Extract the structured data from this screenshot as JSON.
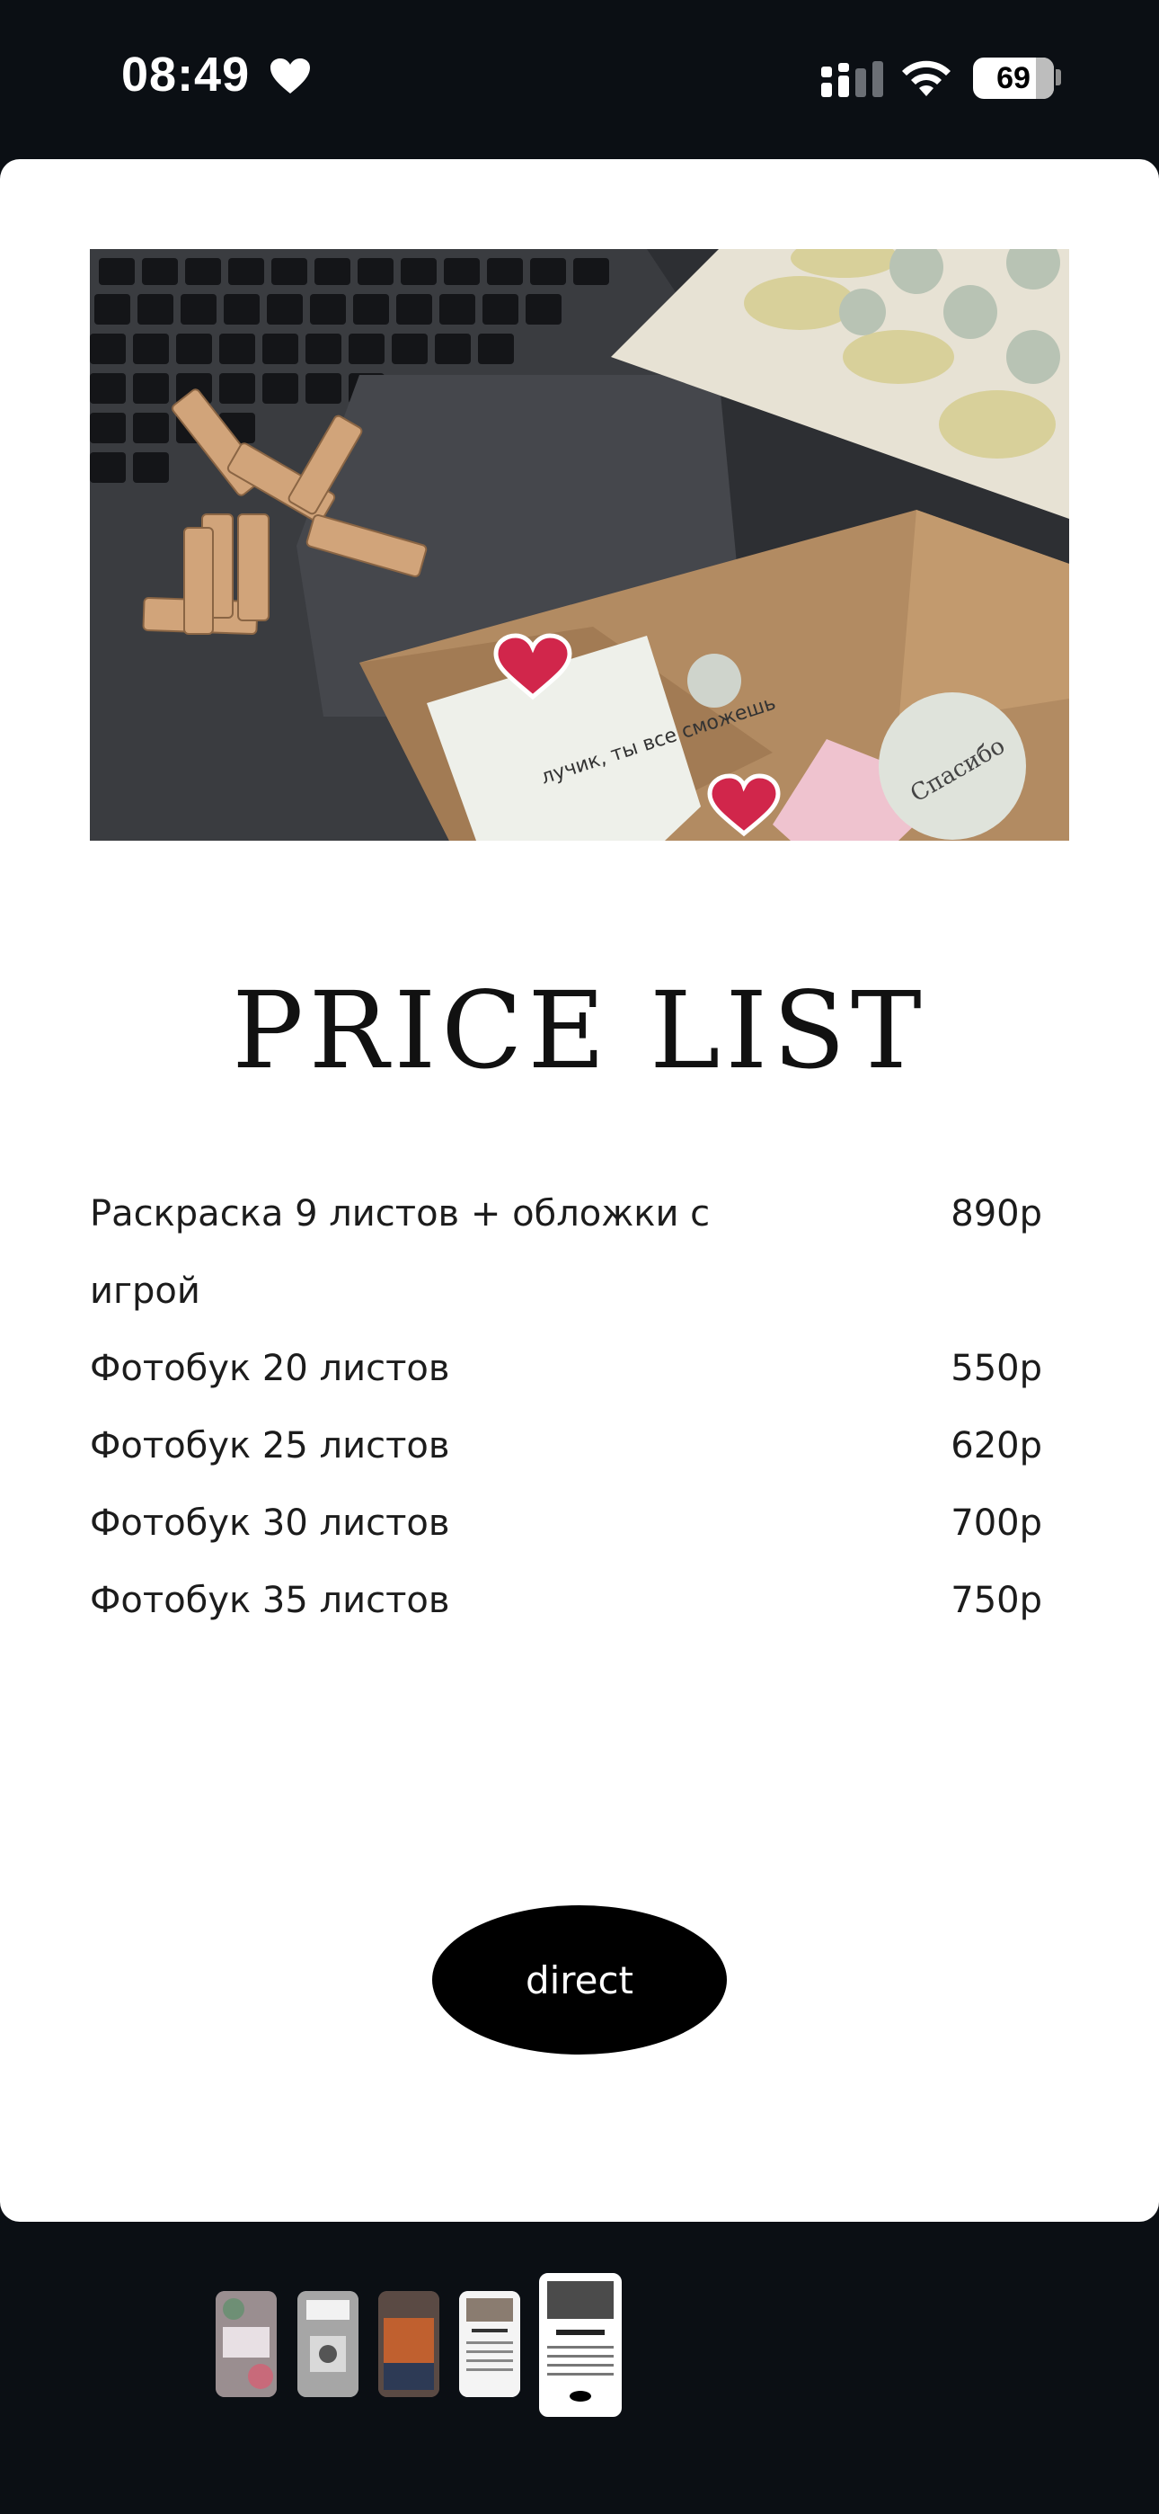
{
  "status_bar": {
    "time": "08:49",
    "battery": "69",
    "icons": [
      "heart-icon",
      "signal-icon",
      "wifi-icon",
      "battery-icon"
    ]
  },
  "hero": {
    "note_text": "лучик, ты все сможешь",
    "sticker_text": "Спасибо"
  },
  "title": "PRICE LIST",
  "price_items": [
    {
      "name": "Раскраска 9 листов + обложки с игрой",
      "price": "890р"
    },
    {
      "name": "Фотобук 20 листов",
      "price": "550р"
    },
    {
      "name": "Фотобук 25 листов",
      "price": "620р"
    },
    {
      "name": "Фотобук 30 листов",
      "price": "700р"
    },
    {
      "name": "Фотобук 35 листов",
      "price": "750р"
    }
  ],
  "direct_label": "direct",
  "thumbnails": {
    "count": 5,
    "active_index": 4
  },
  "colors": {
    "background": "#0b0f14",
    "card": "#ffffff",
    "button": "#000000"
  }
}
